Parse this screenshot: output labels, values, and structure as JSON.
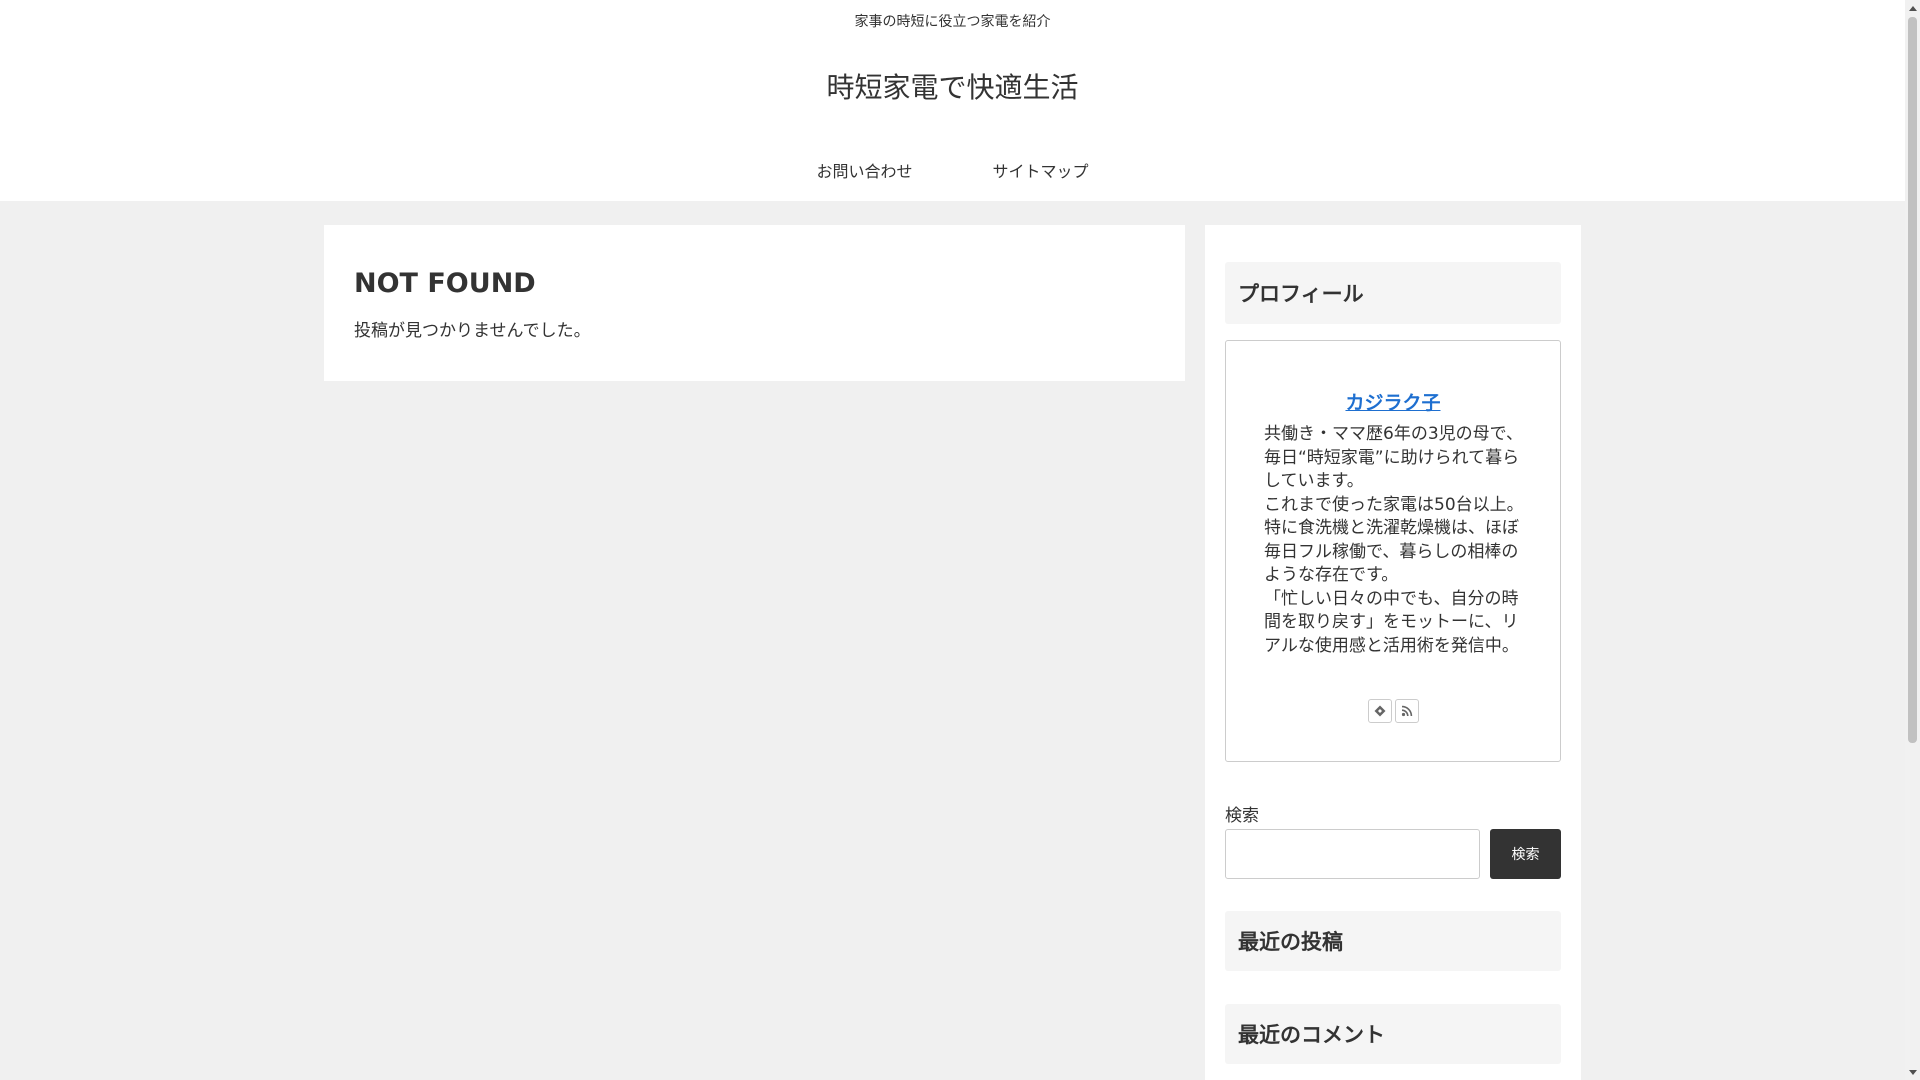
{
  "header": {
    "tagline": "家事の時短に役立つ家電を紹介",
    "site_title": "時短家電で快適生活",
    "nav": [
      {
        "label": "お問い合わせ"
      },
      {
        "label": "サイトマップ"
      }
    ]
  },
  "main": {
    "title": "NOT FOUND",
    "message": "投稿が見つかりませんでした。"
  },
  "sidebar": {
    "profile": {
      "widget_title": "プロフィール",
      "name": "カジラク子",
      "description": "共働き・ママ歴6年の3児の母で、毎日“時短家電”に助けられて暮らしています。\nこれまで使った家電は50台以上。特に食洗機と洗濯乾燥機は、ほぼ毎日フル稼働で、暮らしの相棒のような存在です。\n「忙しい日々の中でも、自分の時間を取り戻す」をモットーに、リアルな使用感と活用術を発信中。",
      "icons": [
        "feedly-icon",
        "rss-icon"
      ]
    },
    "search": {
      "label": "検索",
      "input_value": "",
      "button_label": "検索"
    },
    "recent_posts_title": "最近の投稿",
    "recent_comments_title": "最近のコメント"
  },
  "colors": {
    "page_background": "#f0f0f0",
    "card_background": "#ffffff",
    "text": "#333333",
    "link": "#1e6fd0",
    "search_button": "#333333",
    "widget_title_background": "#f5f5f5"
  }
}
